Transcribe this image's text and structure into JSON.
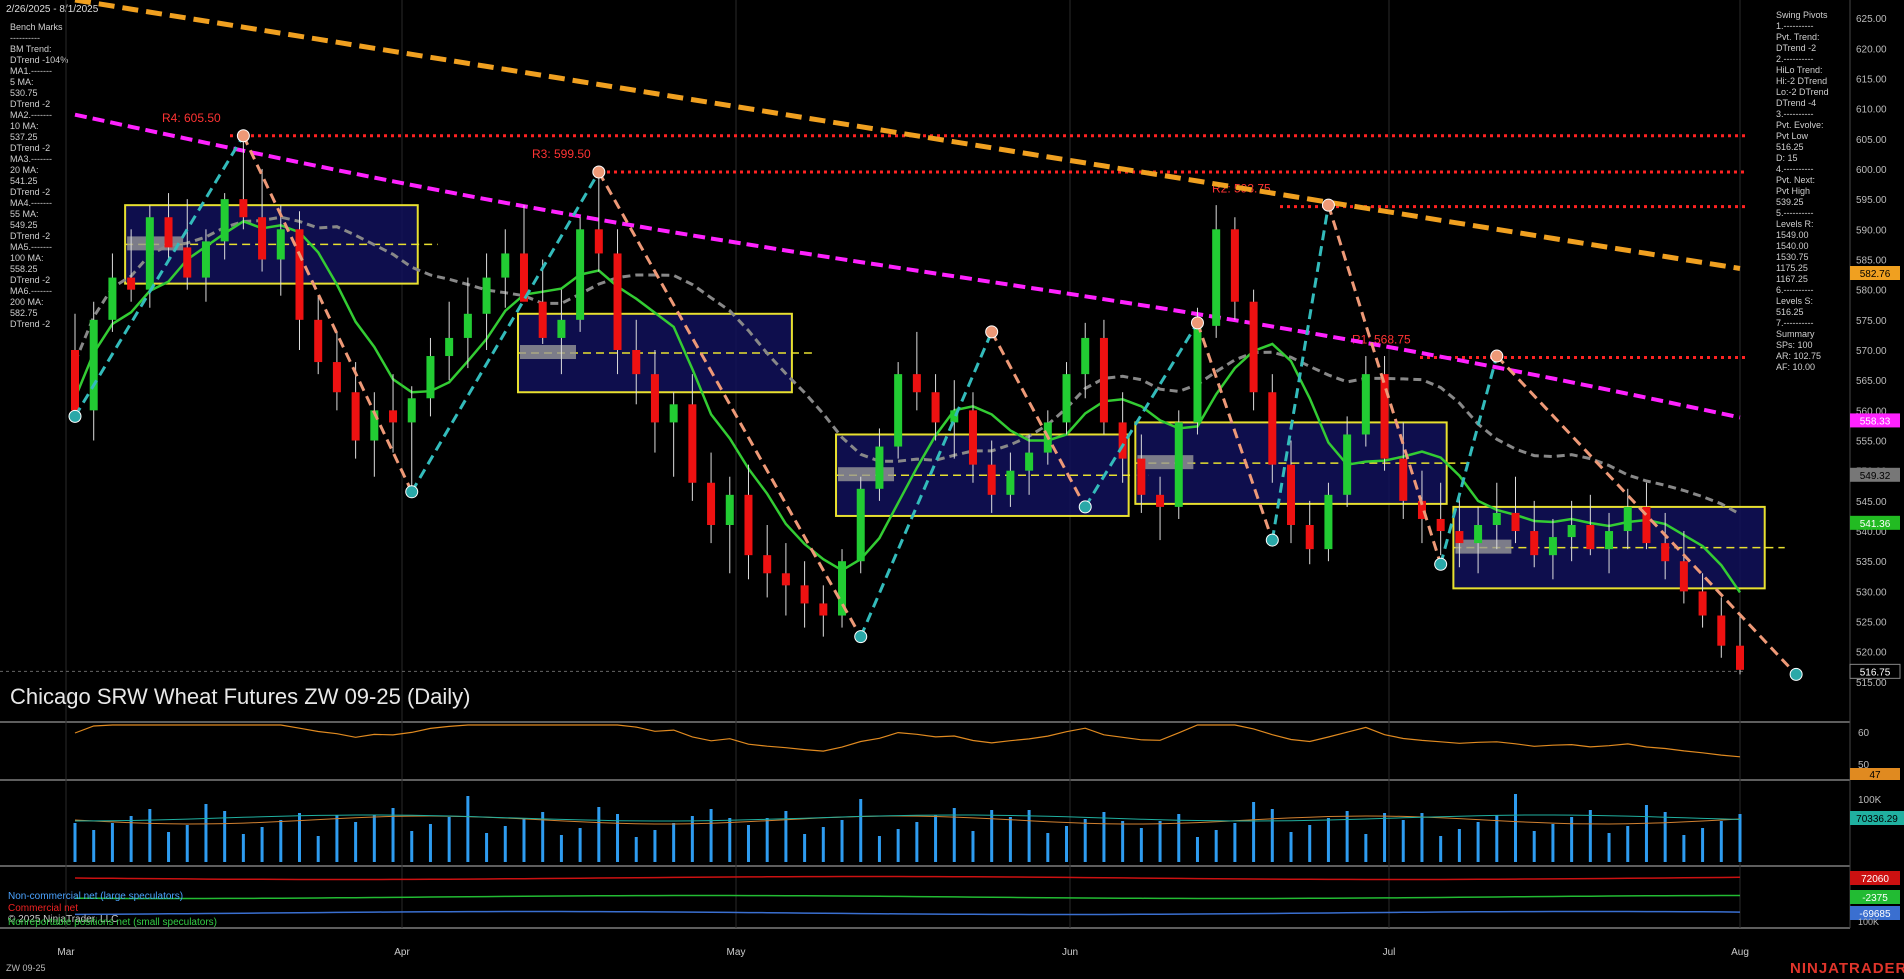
{
  "header": {
    "date_range": "2/26/2025 - 8/1/2025"
  },
  "title": "Chicago SRW Wheat Futures ZW 09-25 (Daily)",
  "footer": {
    "symbol": "ZW 09-25",
    "brand": "NINJATRADER",
    "copyright": "© 2025 NinjaTrader, LLC"
  },
  "left_panel": {
    "lines": [
      "Bench Marks",
      "----------",
      "BM Trend:",
      "DTrend -104%",
      "MA1.-------",
      "5 MA:",
      "530.75",
      "DTrend -2",
      "MA2.-------",
      "10 MA:",
      "537.25",
      "DTrend -2",
      "MA3.-------",
      "20 MA:",
      "541.25",
      "DTrend -2",
      "MA4.-------",
      "55 MA:",
      "549.25",
      "DTrend -2",
      "MA5.-------",
      "100 MA:",
      "558.25",
      "DTrend -2",
      "MA6.-------",
      "200 MA:",
      "582.75",
      "DTrend -2"
    ]
  },
  "right_panel": {
    "lines": [
      "Swing Pivots",
      "1.----------",
      "Pvt. Trend:",
      "DTrend -2",
      "2.----------",
      "HiLo Trend:",
      "Hi:-2 DTrend",
      "Lo:-2 DTrend",
      "DTrend -4",
      "3.----------",
      "Pvt. Evolve:",
      "Pvt Low",
      "516.25",
      "D: 15",
      "4.----------",
      "Pvt. Next:",
      "Pvt High",
      "539.25",
      "5.----------",
      "Levels R:",
      "1549.00",
      "1540.00",
      "1530.75",
      "1175.25",
      "1167.25",
      "6.----------",
      "Levels S:",
      "516.25",
      "7.----------",
      "Summary",
      "SPs: 100",
      "AR: 102.75",
      "AF: 10.00"
    ]
  },
  "legend": {
    "noncommercial": "Non-commercial net (large speculators)",
    "commercial": "Commercial net",
    "nonreportable": "Nonreportable positions net (small speculators)"
  },
  "colors": {
    "up": "#22cc33",
    "down": "#ee1111",
    "ma20": "#33cc33",
    "ma55": "#888888",
    "ma100": "#ff22ff",
    "ma200": "#f0a020",
    "resistance": "#ff2222",
    "swing_up": "#33bbbb",
    "swing_down": "#ee9977"
  },
  "chart_data": [
    {
      "type": "candlestick",
      "title": "Chicago SRW Wheat Futures ZW 09-25 (Daily)",
      "x_ticks": [
        "Mar",
        "Apr",
        "May",
        "Jun",
        "Jul",
        "Aug"
      ],
      "y_ticks": [
        "625.00",
        "620.00",
        "615.00",
        "610.00",
        "605.00",
        "600.00",
        "595.00",
        "590.00",
        "585.00",
        "580.00",
        "575.00",
        "570.00",
        "565.00",
        "560.00",
        "555.00",
        "550.00",
        "545.00",
        "540.00",
        "535.00",
        "530.00",
        "525.00",
        "520.00",
        "515.00"
      ],
      "ylim": [
        512,
        628
      ],
      "resistance_labels": [
        {
          "text": "R4: 605.50",
          "value": 605.5
        },
        {
          "text": "R3: 599.50",
          "value": 599.5
        },
        {
          "text": "R2: 593.75",
          "value": 593.75
        },
        {
          "text": "R1: 568.75",
          "value": 568.75
        }
      ],
      "price_tags": [
        {
          "text": "582.76",
          "value": 582.76,
          "color": "#f0a020"
        },
        {
          "text": "558.33",
          "value": 558.33,
          "color": "#ff22ff"
        },
        {
          "text": "549.32",
          "value": 549.32,
          "color": "#777777"
        },
        {
          "text": "541.36",
          "value": 541.36,
          "color": "#22bb22"
        },
        {
          "text": "516.75",
          "value": 516.75,
          "color": "#000000"
        }
      ],
      "range_boxes": [
        {
          "label": "IB-March",
          "start": 3,
          "end": 18,
          "high": 594,
          "low": 581
        },
        {
          "label": "IB-April",
          "start": 24,
          "end": 38,
          "high": 576,
          "low": 563
        },
        {
          "label": "IB-May",
          "start": 41,
          "end": 56,
          "high": 556,
          "low": 542.5
        },
        {
          "label": "IB-June",
          "start": 57,
          "end": 73,
          "high": 558,
          "low": 544.5
        },
        {
          "label": "IB-July",
          "start": 74,
          "end": 90,
          "high": 544,
          "low": 530.5
        }
      ],
      "swing_points": [
        {
          "i": 0,
          "value": 559,
          "type": "low"
        },
        {
          "i": 9,
          "value": 605.5,
          "type": "high"
        },
        {
          "i": 18,
          "value": 546.5,
          "type": "low"
        },
        {
          "i": 28,
          "value": 599.5,
          "type": "high"
        },
        {
          "i": 42,
          "value": 522.5,
          "type": "low"
        },
        {
          "i": 49,
          "value": 573,
          "type": "high"
        },
        {
          "i": 54,
          "value": 544,
          "type": "low"
        },
        {
          "i": 60,
          "value": 574.5,
          "type": "high"
        },
        {
          "i": 64,
          "value": 538.5,
          "type": "low"
        },
        {
          "i": 67,
          "value": 594,
          "type": "high"
        },
        {
          "i": 73,
          "value": 534.5,
          "type": "low"
        },
        {
          "i": 76,
          "value": 569,
          "type": "high"
        },
        {
          "i": 92,
          "value": 516.25,
          "type": "low"
        }
      ],
      "ohlc": [
        [
          570,
          576,
          558,
          560
        ],
        [
          560,
          578,
          555,
          575
        ],
        [
          575,
          586,
          573,
          582
        ],
        [
          582,
          590,
          578,
          580
        ],
        [
          580,
          594,
          577,
          592
        ],
        [
          592,
          596,
          585,
          587
        ],
        [
          587,
          595,
          580,
          582
        ],
        [
          582,
          590,
          578,
          588
        ],
        [
          588,
          596,
          585,
          595
        ],
        [
          595,
          605.5,
          590,
          592
        ],
        [
          592,
          600,
          583,
          585
        ],
        [
          585,
          594,
          579,
          590
        ],
        [
          590,
          593,
          570,
          575
        ],
        [
          575,
          579,
          566,
          568
        ],
        [
          568,
          573,
          560,
          563
        ],
        [
          563,
          568,
          552,
          555
        ],
        [
          555,
          563,
          549,
          560
        ],
        [
          560,
          566,
          553,
          558
        ],
        [
          558,
          564,
          546.5,
          562
        ],
        [
          562,
          572,
          559,
          569
        ],
        [
          569,
          578,
          565,
          572
        ],
        [
          572,
          582,
          567,
          576
        ],
        [
          576,
          586,
          570,
          582
        ],
        [
          582,
          590,
          577,
          586
        ],
        [
          586,
          594,
          580,
          578
        ],
        [
          578,
          585,
          571,
          572
        ],
        [
          572,
          580,
          566,
          575
        ],
        [
          575,
          592,
          573,
          590
        ],
        [
          590,
          599.5,
          583,
          586
        ],
        [
          586,
          590,
          566,
          570
        ],
        [
          570,
          575,
          561,
          566
        ],
        [
          566,
          570,
          553,
          558
        ],
        [
          558,
          563,
          549,
          561
        ],
        [
          561,
          566,
          545,
          548
        ],
        [
          548,
          553,
          538,
          541
        ],
        [
          541,
          549,
          533,
          546
        ],
        [
          546,
          551,
          532,
          536
        ],
        [
          536,
          541,
          529,
          533
        ],
        [
          533,
          538,
          526,
          531
        ],
        [
          531,
          535,
          524,
          528
        ],
        [
          528,
          531,
          522.5,
          526
        ],
        [
          526,
          537,
          524,
          535
        ],
        [
          535,
          549,
          533,
          547
        ],
        [
          547,
          557,
          545,
          554
        ],
        [
          554,
          568,
          552,
          566
        ],
        [
          566,
          573,
          560,
          563
        ],
        [
          563,
          566,
          555,
          558
        ],
        [
          558,
          565,
          552,
          560
        ],
        [
          560,
          563,
          548,
          551
        ],
        [
          551,
          555,
          543,
          546
        ],
        [
          546,
          553,
          544,
          550
        ],
        [
          550,
          556,
          546,
          553
        ],
        [
          553,
          560,
          551,
          558
        ],
        [
          558,
          568,
          556,
          566
        ],
        [
          566,
          574.5,
          562,
          572
        ],
        [
          572,
          575,
          556,
          558
        ],
        [
          558,
          563,
          548,
          552
        ],
        [
          552,
          556,
          543,
          546
        ],
        [
          546,
          549,
          538.5,
          544
        ],
        [
          544,
          560,
          542,
          558
        ],
        [
          558,
          577,
          556,
          574
        ],
        [
          574,
          594,
          572,
          590
        ],
        [
          590,
          592,
          575,
          578
        ],
        [
          578,
          580,
          560,
          563
        ],
        [
          563,
          566,
          548,
          551
        ],
        [
          551,
          555,
          538,
          541
        ],
        [
          541,
          545,
          534.5,
          537
        ],
        [
          537,
          548,
          535,
          546
        ],
        [
          546,
          559,
          544,
          556
        ],
        [
          556,
          569,
          554,
          566
        ],
        [
          566,
          569,
          550,
          552
        ],
        [
          552,
          558,
          542,
          545
        ],
        [
          545,
          550,
          538,
          542
        ],
        [
          542,
          548,
          536,
          540
        ],
        [
          540,
          546,
          534,
          538
        ],
        [
          538,
          544,
          533,
          541
        ],
        [
          541,
          548,
          537,
          543
        ],
        [
          543,
          549,
          538,
          540
        ],
        [
          540,
          545,
          534,
          536
        ],
        [
          536,
          542,
          532,
          539
        ],
        [
          539,
          545,
          535,
          541
        ],
        [
          541,
          546,
          536,
          537
        ],
        [
          537,
          543,
          533,
          540
        ],
        [
          540,
          547,
          537,
          544
        ],
        [
          544,
          548,
          537,
          538
        ],
        [
          538,
          543,
          532,
          535
        ],
        [
          535,
          540,
          528,
          530
        ],
        [
          530,
          533,
          524,
          526
        ],
        [
          526,
          529,
          519,
          521
        ],
        [
          521,
          526,
          516.25,
          517
        ]
      ]
    },
    {
      "type": "line",
      "name": "oscillator",
      "y_ticks": [
        "60",
        "50"
      ],
      "current_value": "47"
    },
    {
      "type": "bar",
      "name": "volume",
      "y_ticks": [
        "100K"
      ],
      "current_value": "70336.29"
    },
    {
      "type": "line",
      "name": "COT",
      "y_ticks": [
        "100K"
      ],
      "series": [
        {
          "name": "Commercial net",
          "current_value": "72060"
        },
        {
          "name": "Nonreportable positions net (small speculators)",
          "current_value": "-2375"
        },
        {
          "name": "Non-commercial net (large speculators)",
          "current_value": "-69685"
        }
      ]
    }
  ]
}
